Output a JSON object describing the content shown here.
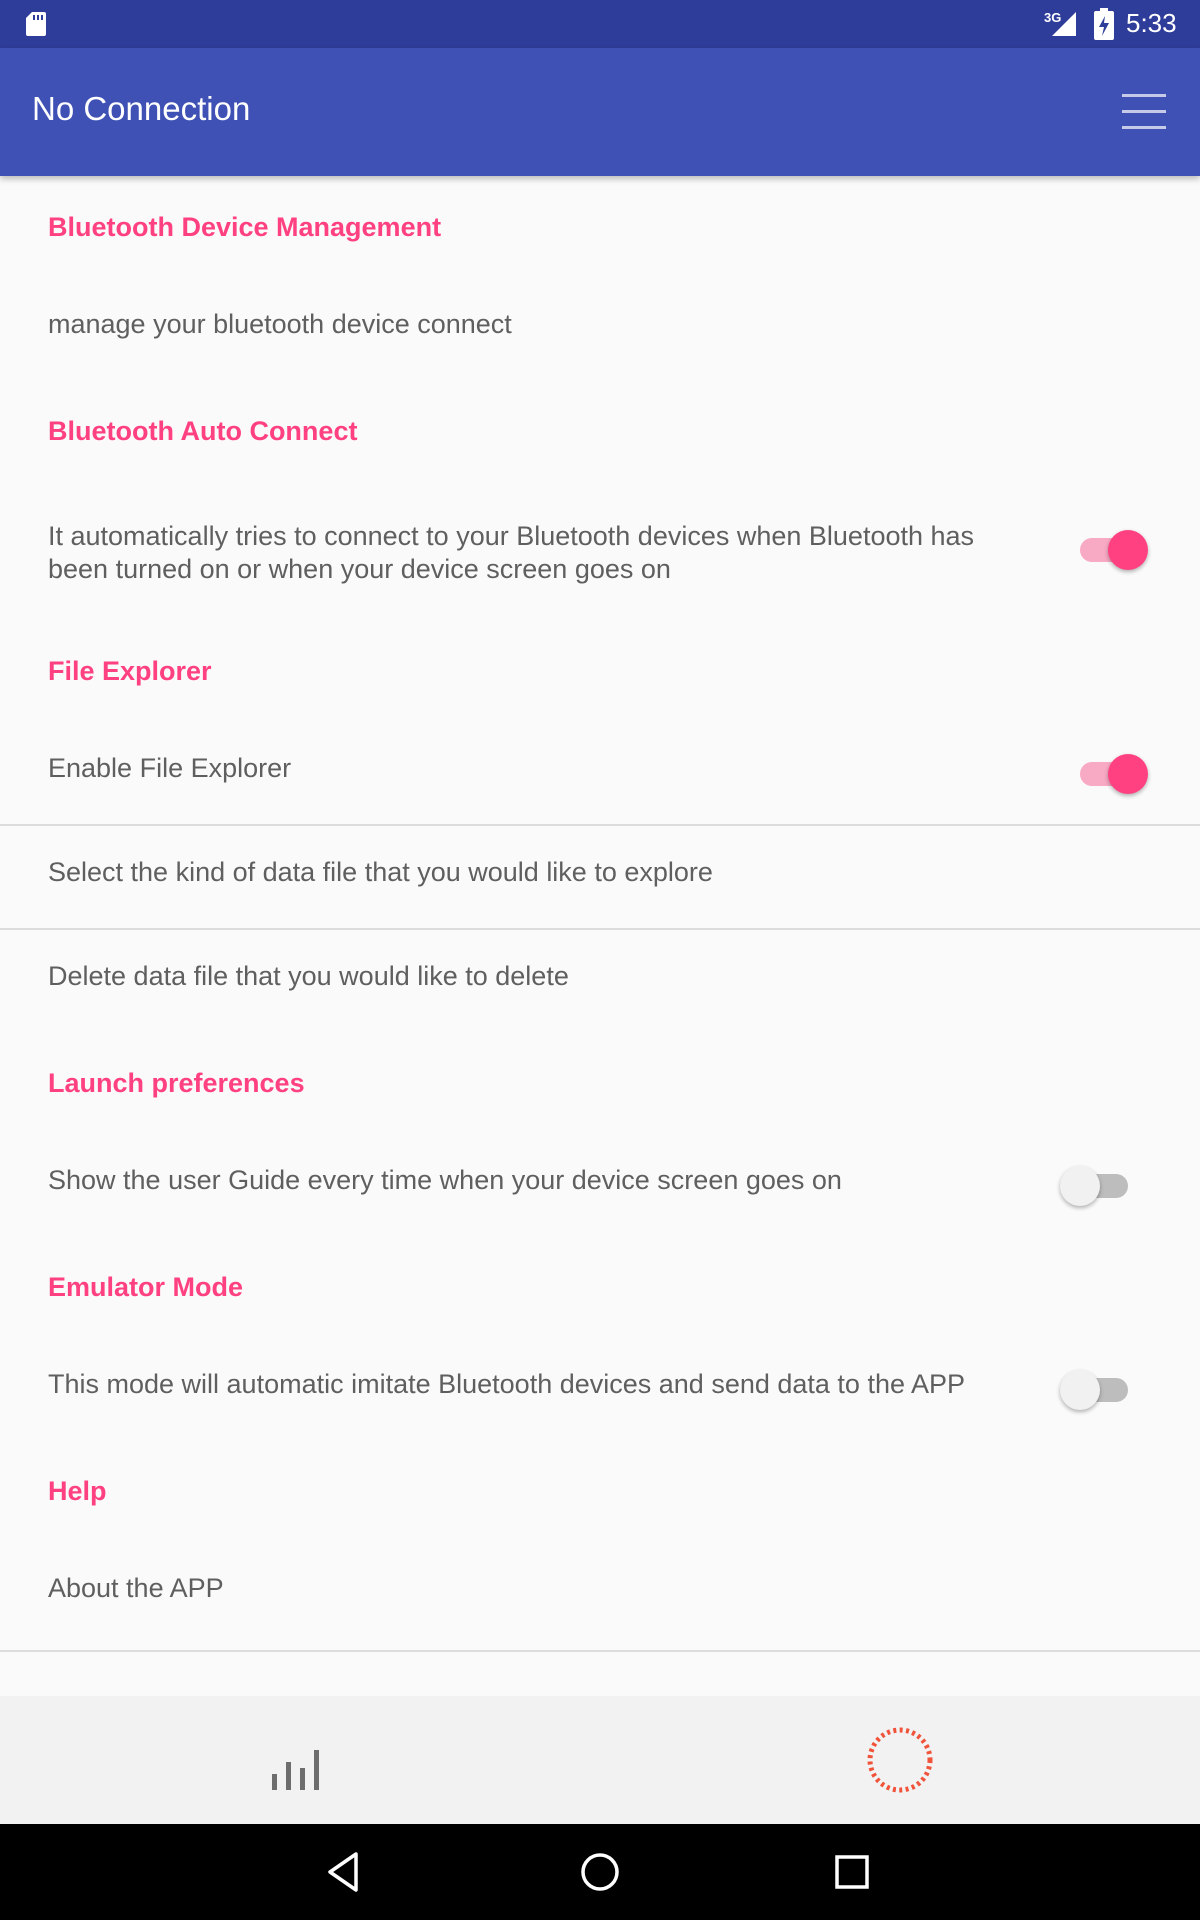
{
  "status_bar": {
    "network_type": "3G",
    "time": "5:33",
    "icons": [
      "sd-card-icon",
      "signal-icon",
      "battery-charging-icon"
    ]
  },
  "app_bar": {
    "title": "No Connection",
    "menu_icon": "menu-icon"
  },
  "preferences": {
    "bluetooth_device_management": {
      "title": "Bluetooth Device Management",
      "summary": "manage your bluetooth device connect"
    },
    "bluetooth_auto_connect": {
      "title": "Bluetooth Auto Connect",
      "summary_line1": "It automatically tries to connect to your Bluetooth devices when Bluetooth has",
      "summary_line2": "been turned on or when your device screen goes on",
      "enabled": true
    },
    "file_explorer": {
      "title": "File Explorer",
      "enable_label": "Enable File Explorer",
      "enabled": true,
      "select_label": "Select the kind of data file that you would like to explore",
      "delete_label": "Delete data file that you would like to delete"
    },
    "launch_preferences": {
      "title": "Launch preferences",
      "guide_label": "Show the user Guide every time when your device screen goes on",
      "guide_enabled": false
    },
    "emulator_mode": {
      "title": "Emulator Mode",
      "summary": "This mode will automatic imitate Bluetooth devices and send data to the APP",
      "enabled": false
    },
    "help": {
      "title": "Help",
      "about_label": "About the APP"
    }
  },
  "bottom_tabs": [
    {
      "icon": "bar-chart-icon"
    },
    {
      "icon": "connection-status-icon"
    }
  ],
  "nav_bar": {
    "icons": [
      "back-icon",
      "home-icon",
      "recent-apps-icon"
    ]
  },
  "colors": {
    "status_bar": "#2f3d9a",
    "app_bar": "#3f51b5",
    "accent": "#ff4081",
    "connection_ring": "#f0533a"
  }
}
